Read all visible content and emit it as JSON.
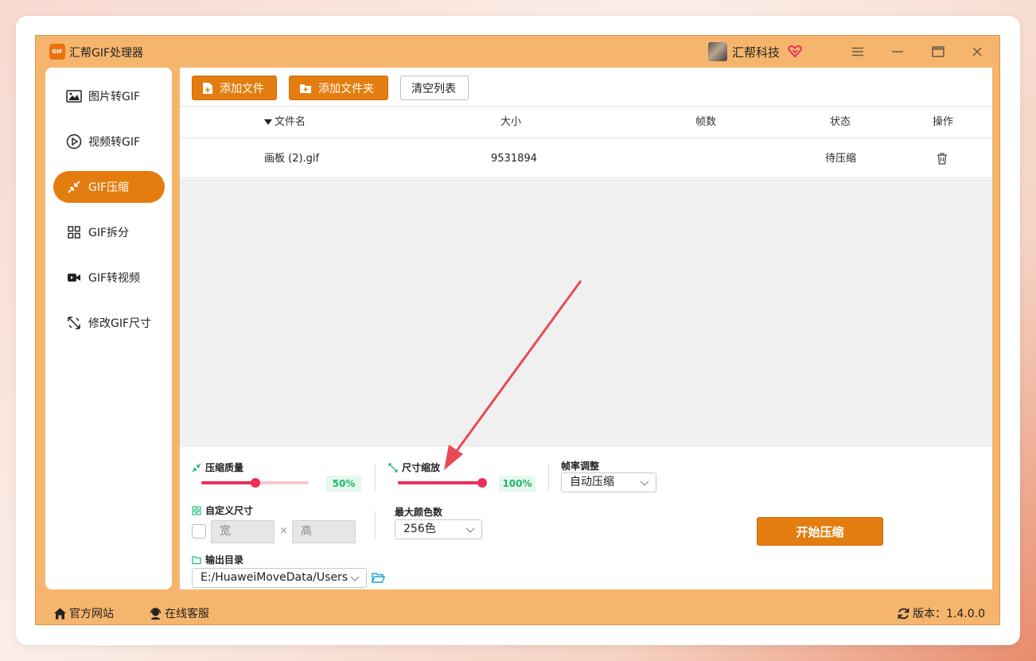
{
  "app": {
    "logo_text": "GIF",
    "title": "汇帮GIF处理器",
    "user_name": "汇帮科技"
  },
  "colors": {
    "accent": "#e47d0f",
    "frame": "#f6b56c",
    "slider": "#e8305a",
    "percent_text": "#20b76c"
  },
  "sidebar": {
    "items": [
      {
        "label": "图片转GIF",
        "icon": "image-icon"
      },
      {
        "label": "视频转GIF",
        "icon": "play-circle-icon"
      },
      {
        "label": "GIF压缩",
        "icon": "compress-icon",
        "active": true
      },
      {
        "label": "GIF拆分",
        "icon": "split-grid-icon"
      },
      {
        "label": "GIF转视频",
        "icon": "video-camera-icon"
      },
      {
        "label": "修改GIF尺寸",
        "icon": "resize-icon"
      }
    ]
  },
  "toolbar": {
    "add_file": "添加文件",
    "add_folder": "添加文件夹",
    "clear_list": "清空列表"
  },
  "table": {
    "headers": {
      "name": "文件名",
      "size": "大小",
      "frames": "帧数",
      "status": "状态",
      "action": "操作"
    },
    "rows": [
      {
        "name": "画板 (2).gif",
        "size": "9531894",
        "frames": "",
        "status": "待压缩"
      }
    ]
  },
  "settings": {
    "quality": {
      "label": "压缩质量",
      "value_text": "50%",
      "value": 0.5
    },
    "scale": {
      "label": "尺寸缩放",
      "value_text": "100%",
      "value": 1.0
    },
    "framerate": {
      "label": "帧率调整",
      "selected": "自动压缩"
    },
    "custom_size": {
      "label": "自定义尺寸",
      "width_placeholder": "宽",
      "height_placeholder": "高",
      "times": "×"
    },
    "max_colors": {
      "label": "最大颜色数",
      "selected": "256色"
    },
    "output": {
      "label": "输出目录",
      "path": "E:/HuaweiMoveData/Users"
    },
    "start": "开始压缩"
  },
  "bottombar": {
    "website": "官方网站",
    "support": "在线客服",
    "version": "版本：1.4.0.0"
  }
}
